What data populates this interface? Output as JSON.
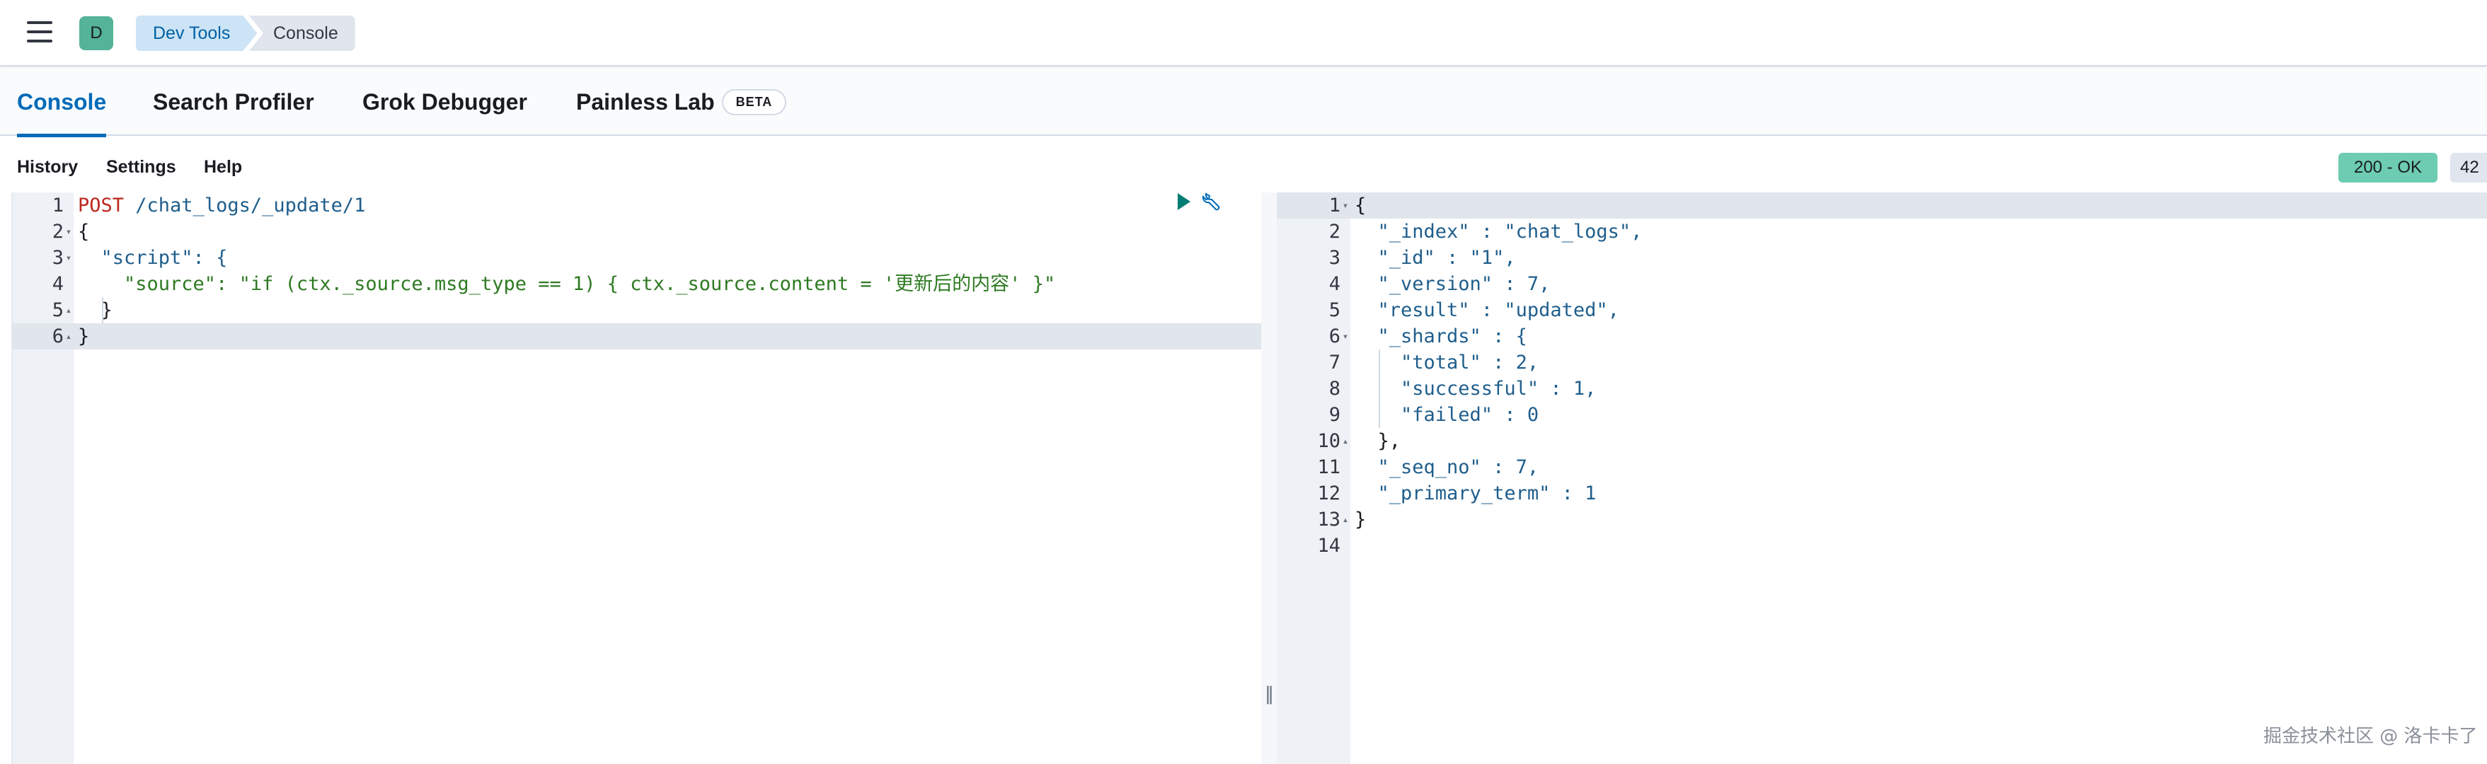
{
  "header": {
    "avatar_letter": "D",
    "breadcrumbs": [
      "Dev Tools",
      "Console"
    ]
  },
  "tabs": [
    {
      "label": "Console",
      "active": true
    },
    {
      "label": "Search Profiler",
      "active": false
    },
    {
      "label": "Grok Debugger",
      "active": false
    },
    {
      "label": "Painless Lab",
      "active": false,
      "badge": "BETA"
    }
  ],
  "toolbar": {
    "history": "History",
    "settings": "Settings",
    "help": "Help",
    "status": "200 - OK",
    "timing": "42"
  },
  "request": {
    "line_numbers": [
      "1",
      "2",
      "3",
      "4",
      "5",
      "6"
    ],
    "method": "POST",
    "url": " /chat_logs/_update/1",
    "lines": [
      "{",
      "  \"script\": {",
      "    \"source\": \"if (ctx._source.msg_type == 1) { ctx._source.content = '更新后的内容' }\"",
      "  }",
      "}"
    ]
  },
  "response": {
    "line_numbers": [
      "1",
      "2",
      "3",
      "4",
      "5",
      "6",
      "7",
      "8",
      "9",
      "10",
      "11",
      "12",
      "13",
      "14"
    ],
    "lines": [
      "{",
      "  \"_index\" : \"chat_logs\",",
      "  \"_id\" : \"1\",",
      "  \"_version\" : 7,",
      "  \"result\" : \"updated\",",
      "  \"_shards\" : {",
      "    \"total\" : 2,",
      "    \"successful\" : 1,",
      "    \"failed\" : 0",
      "  },",
      "  \"_seq_no\" : 7,",
      "  \"_primary_term\" : 1",
      "}",
      ""
    ]
  },
  "watermark": "掘金技术社区 @ 洛卡卡了",
  "colors": {
    "accent": "#006bb8",
    "status_ok": "#6dccb1",
    "avatar": "#54b399"
  }
}
